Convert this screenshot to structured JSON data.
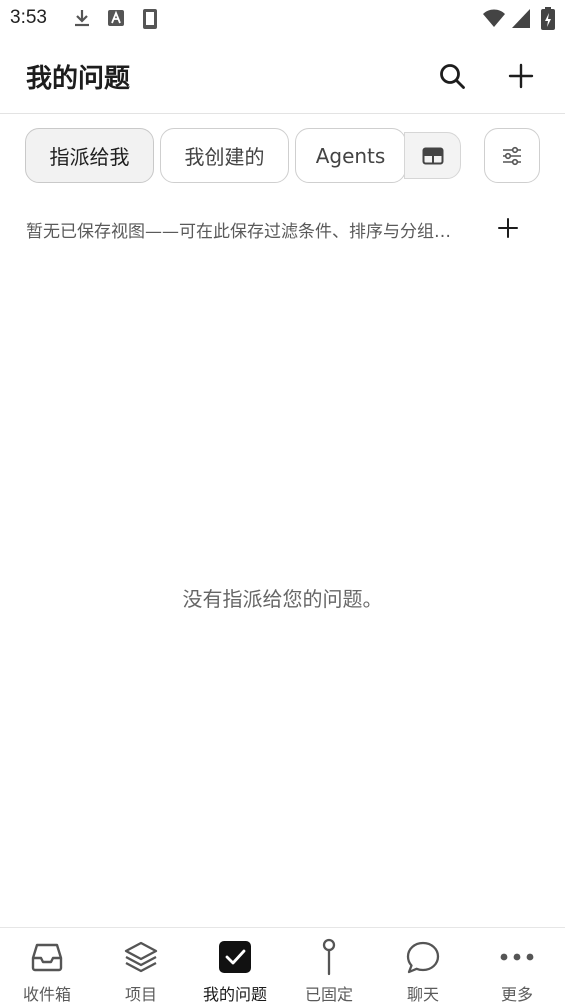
{
  "status_bar": {
    "time": "3:53",
    "icons": [
      "download-icon",
      "a-icon",
      "sd-card-icon",
      "wifi-icon",
      "signal-icon",
      "battery-charging-icon"
    ]
  },
  "app_bar": {
    "title": "我的问题",
    "actions": [
      "search-icon",
      "plus-icon"
    ]
  },
  "filters": {
    "tabs": [
      {
        "label": "指派给我",
        "active": true
      },
      {
        "label": "我创建的",
        "active": false
      },
      {
        "label": "Agents",
        "active": false
      }
    ],
    "view_toggle_icon": "table-icon",
    "filter_icon": "sliders-icon"
  },
  "saved_views": {
    "message": "暂无已保存视图——可在此保存过滤条件、排序与分组设置",
    "add_icon": "plus-icon"
  },
  "empty_state": {
    "message": "没有指派给您的问题。"
  },
  "bottom_nav": {
    "items": [
      {
        "label": "收件箱",
        "icon": "inbox-icon",
        "active": false
      },
      {
        "label": "项目",
        "icon": "layers-icon",
        "active": false
      },
      {
        "label": "我的问题",
        "icon": "checkbox-icon",
        "active": true
      },
      {
        "label": "已固定",
        "icon": "pin-icon",
        "active": false
      },
      {
        "label": "聊天",
        "icon": "chat-icon",
        "active": false
      },
      {
        "label": "更多",
        "icon": "more-icon",
        "active": false
      }
    ]
  },
  "colors": {
    "text_primary": "#1d1d1d",
    "text_secondary": "#5a5a5a",
    "border": "#cfcfcf",
    "chip_active_bg": "#f2f2f2"
  }
}
